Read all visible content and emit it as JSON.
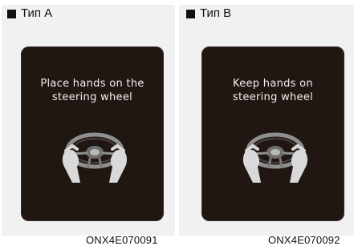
{
  "panels": [
    {
      "heading": "Тип A",
      "message_line1": "Place hands on the",
      "message_line2": "steering wheel",
      "icon": "hands-on-steering-wheel-icon",
      "image_code": "ONX4E070091"
    },
    {
      "heading": "Тип B",
      "message_line1": "Keep hands on",
      "message_line2": "steering wheel",
      "icon": "hands-on-steering-wheel-icon",
      "image_code": "ONX4E070092"
    }
  ],
  "colors": {
    "screen_background": "#201713",
    "screen_text": "#f3f0ee",
    "wheel": "#8f8f8f",
    "hands": "#d9d9d9"
  }
}
